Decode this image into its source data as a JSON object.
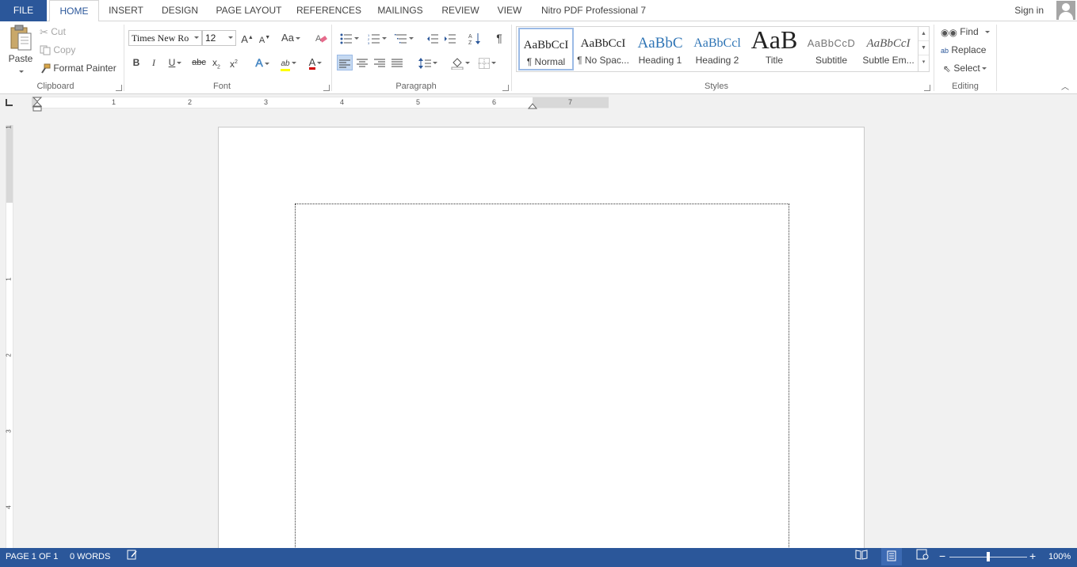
{
  "tabs": {
    "file": "FILE",
    "home": "HOME",
    "insert": "INSERT",
    "design": "DESIGN",
    "page_layout": "PAGE LAYOUT",
    "references": "REFERENCES",
    "mailings": "MAILINGS",
    "review": "REVIEW",
    "view": "VIEW",
    "nitro": "Nitro PDF Professional 7"
  },
  "account": {
    "signin": "Sign in"
  },
  "clipboard": {
    "group_label": "Clipboard",
    "paste": "Paste",
    "cut": "Cut",
    "copy": "Copy",
    "format_painter": "Format Painter"
  },
  "font": {
    "group_label": "Font",
    "name": "Times New Ro",
    "size": "12",
    "grow": "A",
    "shrink": "A",
    "change_case": "Aa",
    "bold": "B",
    "italic": "I",
    "underline": "U",
    "strikethrough": "abc",
    "subscript": "x",
    "subscript_mark": "2",
    "superscript": "x",
    "superscript_mark": "2",
    "text_effects": "A",
    "highlight": "ab",
    "font_color": "A",
    "highlight_color": "#ffff00",
    "font_color_bar": "#d00000"
  },
  "paragraph": {
    "group_label": "Paragraph",
    "show_marks": "¶"
  },
  "styles": {
    "group_label": "Styles",
    "items": [
      {
        "preview": "AaBbCcI",
        "name": "¶ Normal"
      },
      {
        "preview": "AaBbCcI",
        "name": "¶ No Spac..."
      },
      {
        "preview": "AaBbC",
        "name": "Heading 1"
      },
      {
        "preview": "AaBbCcl",
        "name": "Heading 2"
      },
      {
        "preview": "AaB",
        "name": "Title"
      },
      {
        "preview": "AaBbCcD",
        "name": "Subtitle"
      },
      {
        "preview": "AaBbCcI",
        "name": "Subtle Em..."
      }
    ]
  },
  "editing": {
    "group_label": "Editing",
    "find": "Find",
    "replace": "Replace",
    "select": "Select"
  },
  "ruler": {
    "h_numbers": [
      "1",
      "2",
      "3",
      "4",
      "5",
      "6",
      "7"
    ],
    "v_numbers": [
      "1",
      "1",
      "2",
      "3",
      "4"
    ]
  },
  "status": {
    "page": "PAGE 1 OF 1",
    "words": "0 WORDS",
    "zoom": "100%",
    "zoom_value": 1.0
  },
  "colors": {
    "accent": "#2b579a",
    "selected_style_border": "#9cbbe6",
    "heading_blue": "#2e74b5"
  }
}
